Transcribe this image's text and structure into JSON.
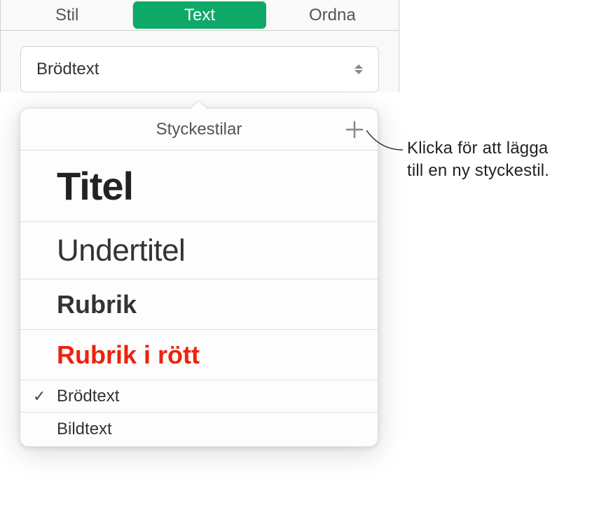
{
  "tabs": {
    "stil": "Stil",
    "text": "Text",
    "ordna": "Ordna"
  },
  "dropdown": {
    "selected": "Brödtext"
  },
  "popover": {
    "title": "Styckestilar",
    "styles": {
      "titel": "Titel",
      "undertitel": "Undertitel",
      "rubrik": "Rubrik",
      "rubrik_rott": "Rubrik i rött",
      "brodtext": "Brödtext",
      "bildtext": "Bildtext"
    },
    "checkmark": "✓"
  },
  "callout": {
    "line1": "Klicka för att lägga",
    "line2": "till en ny styckestil."
  }
}
